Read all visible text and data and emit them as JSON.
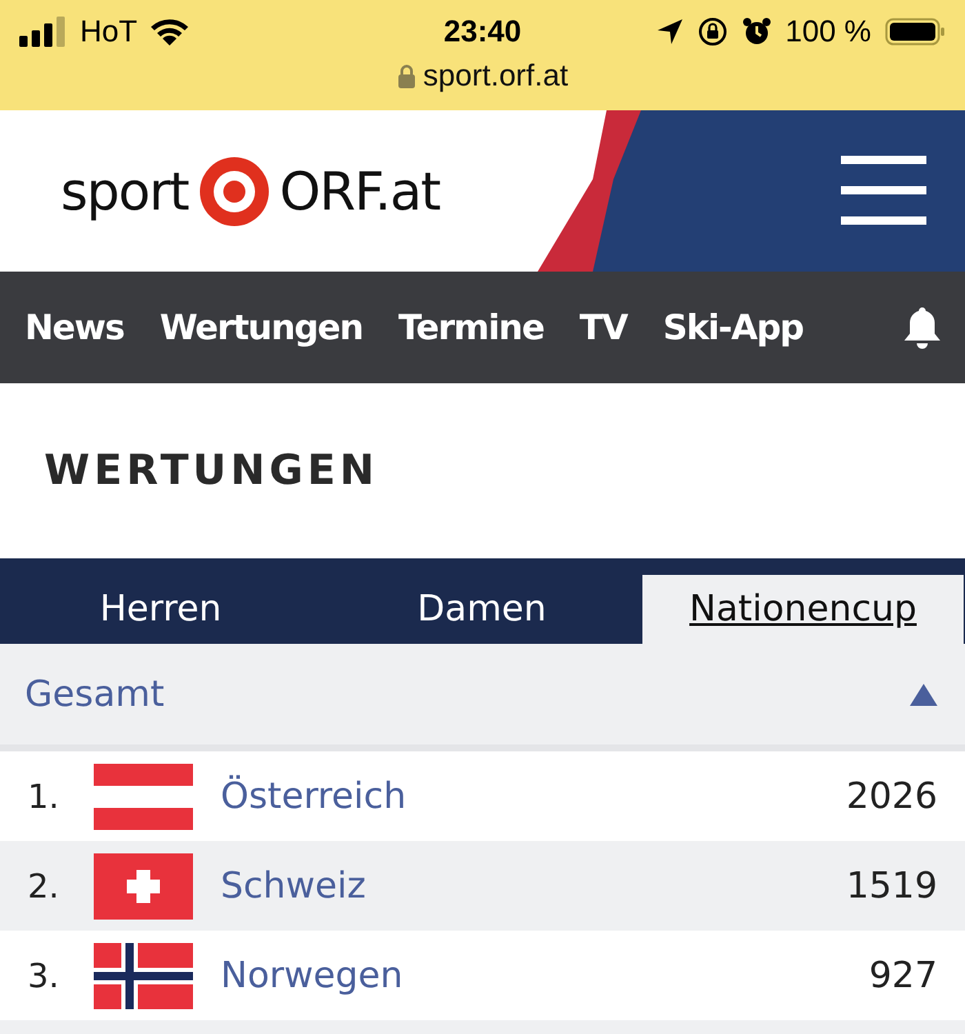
{
  "status_bar": {
    "carrier": "HoT",
    "time": "23:40",
    "battery": "100 %",
    "url": "sport.orf.at"
  },
  "header": {
    "logo_left": "sport",
    "logo_right": "ORF.at"
  },
  "nav": {
    "items": [
      {
        "label": "News"
      },
      {
        "label": "Wertungen"
      },
      {
        "label": "Termine"
      },
      {
        "label": "TV"
      },
      {
        "label": "Ski-App"
      }
    ]
  },
  "page_title": "WERTUNGEN",
  "tabs": [
    {
      "label": "Herren",
      "selected": false
    },
    {
      "label": "Damen",
      "selected": false
    },
    {
      "label": "Nationencup",
      "selected": true
    }
  ],
  "section": {
    "title": "Gesamt",
    "expanded": true
  },
  "rows": [
    {
      "rank": "1.",
      "kind": "austria",
      "country": "Österreich",
      "points": "2026"
    },
    {
      "rank": "2.",
      "kind": "switzerland",
      "country": "Schweiz",
      "points": "1519"
    },
    {
      "rank": "3.",
      "kind": "norway",
      "country": "Norwegen",
      "points": "927"
    }
  ]
}
